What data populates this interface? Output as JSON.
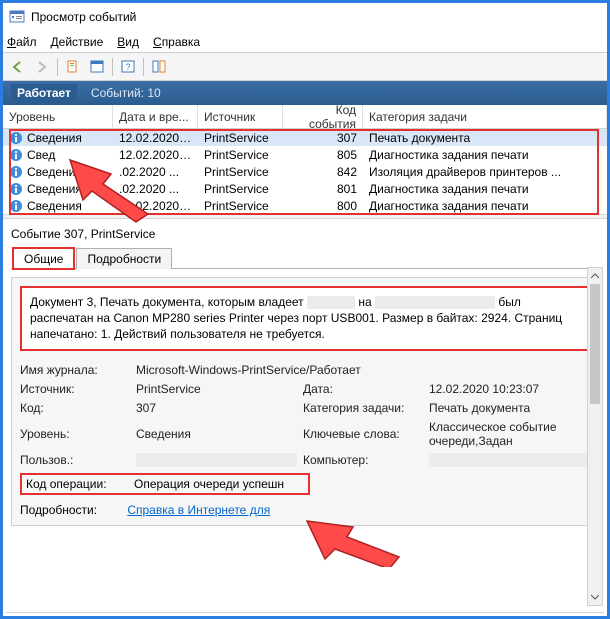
{
  "window": {
    "title": "Просмотр событий"
  },
  "menu": {
    "file": "Файл",
    "action": "Действие",
    "view": "Вид",
    "help": "Справка"
  },
  "status": {
    "label": "Работает",
    "count_label": "Событий: 10"
  },
  "columns": {
    "level": "Уровень",
    "date": "Дата и вре...",
    "source": "Источник",
    "code": "Код события",
    "category": "Категория задачи"
  },
  "rows": [
    {
      "level": "Сведения",
      "date": "12.02.2020 ...",
      "source": "PrintService",
      "code": "307",
      "category": "Печать документа"
    },
    {
      "level": "Свед",
      "date": "12.02.2020 ...",
      "source": "PrintService",
      "code": "805",
      "category": "Диагностика задания печати"
    },
    {
      "level": "Сведения",
      "date": ".02.2020 ...",
      "source": "PrintService",
      "code": "842",
      "category": "Изоляция драйверов принтеров ..."
    },
    {
      "level": "Сведения",
      "date": ".02.2020 ...",
      "source": "PrintService",
      "code": "801",
      "category": "Диагностика задания печати"
    },
    {
      "level": "Сведения",
      "date": "12.02.2020 ...",
      "source": "PrintService",
      "code": "800",
      "category": "Диагностика задания печати"
    }
  ],
  "detail": {
    "header": "Событие 307, PrintService",
    "tabs": {
      "general": "Общие",
      "details": "Подробности"
    },
    "desc_p1a": "Документ 3, Печать документа, которым владеет",
    "desc_p1b": "на",
    "desc_p1c": "был распечатан на",
    "desc_p2": "Canon MP280 series Printer через порт USB001.  Размер в байтах: 2924. Страниц напечатано: 1.",
    "desc_p3": "Действий пользователя не требуется.",
    "labels": {
      "journal": "Имя журнала:",
      "source": "Источник:",
      "code": "Код:",
      "level": "Уровень:",
      "user": "Пользов.:",
      "op": "Код операции:",
      "date": "Дата:",
      "cat": "Категория задачи:",
      "keys": "Ключевые слова:",
      "comp": "Компьютер:",
      "more": "Подробности:"
    },
    "values": {
      "journal": "Microsoft-Windows-PrintService/Работает",
      "source": "PrintService",
      "code": "307",
      "level": "Сведения",
      "date": "12.02.2020 10:23:07",
      "cat": "Печать документа",
      "keys": "Классическое событие очереди,Задан",
      "op": "Операция очереди успешн"
    },
    "link": "Справка в Интернете для "
  }
}
